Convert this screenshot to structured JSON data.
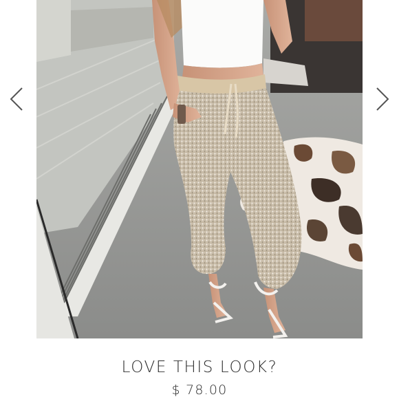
{
  "carousel": {
    "prev_icon": "chevron-left-icon",
    "next_icon": "chevron-right-icon",
    "arrow_color": "#555555"
  },
  "product": {
    "image_alt": "Model wearing sequin jogger pants",
    "headline": "LOVE THIS LOOK?",
    "price": "$ 78.00"
  }
}
